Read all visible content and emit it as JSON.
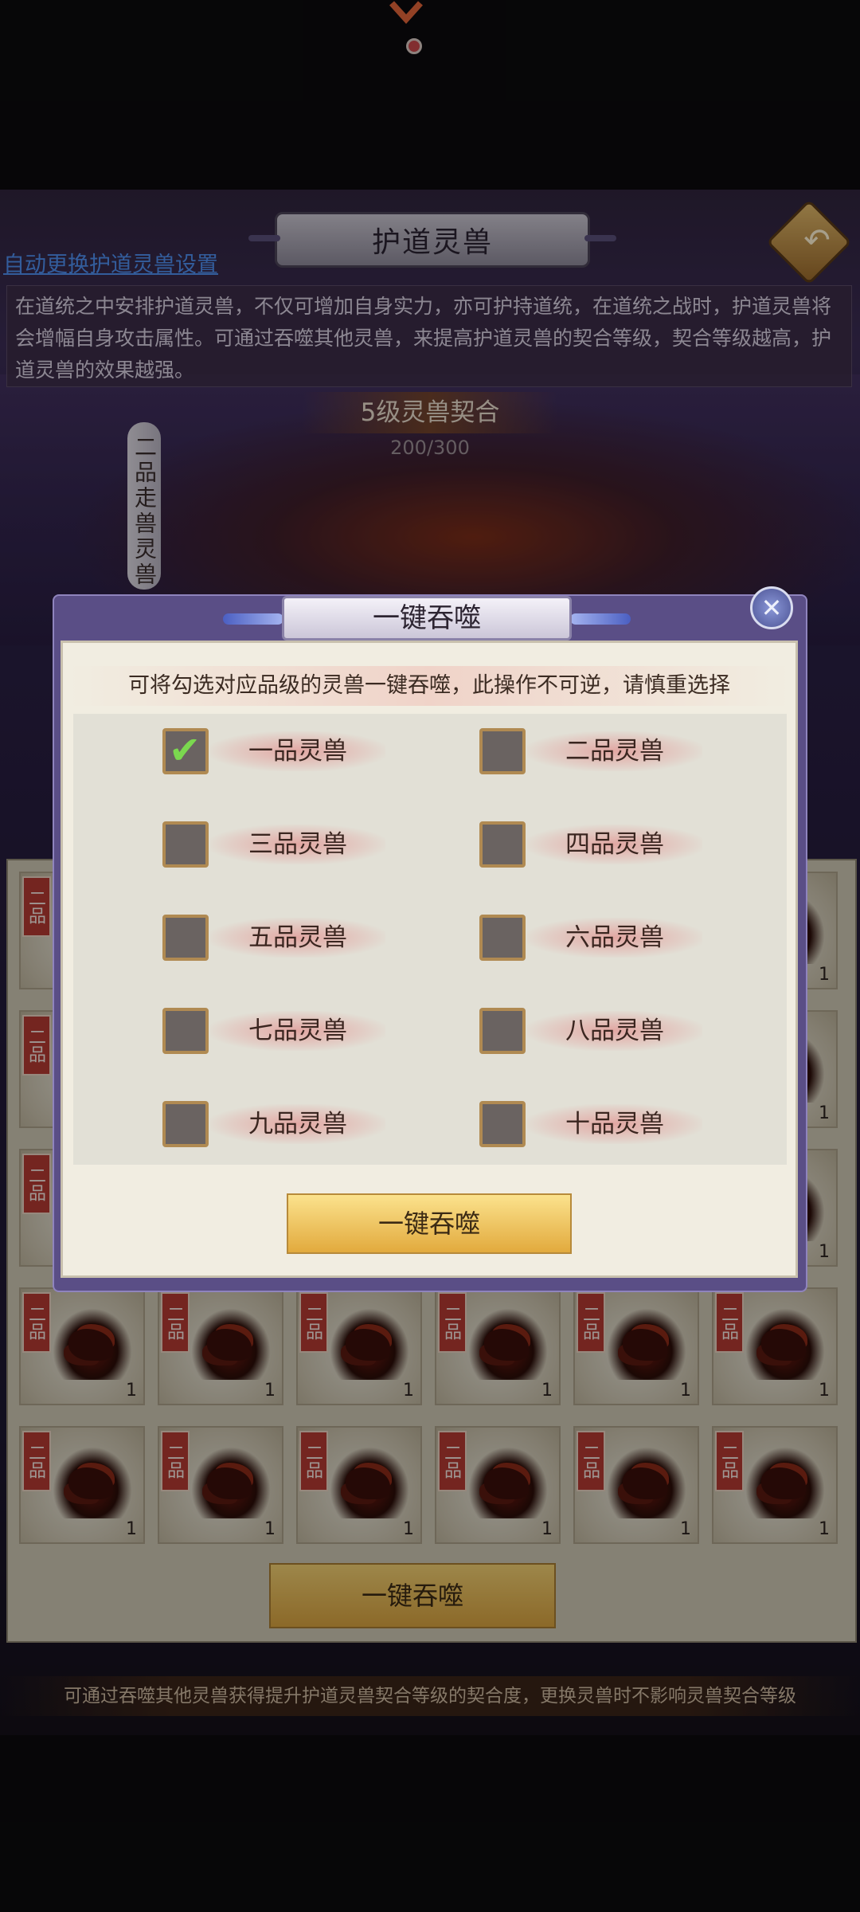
{
  "header": {
    "title": "护道灵兽",
    "auto_link": "自动更换护道灵兽设置",
    "description": "在道统之中安排护道灵兽，不仅可增加自身实力，亦可护持道统，在道统之战时，护道灵兽将会增幅自身攻击属性。可通过吞噬其他灵兽，来提高护道灵兽的契合等级，契合等级越高，护道灵兽的效果越强。"
  },
  "beast": {
    "bond_level": "5级灵兽契合",
    "bond_progress": "200/300",
    "name_vertical": "二品走兽灵兽"
  },
  "grid": {
    "badge": "二品",
    "count": "1",
    "eat_button": "一键吞噬"
  },
  "bottom_note": "可通过吞噬其他灵兽获得提升护道灵兽契合等级的契合度，更换灵兽时不影响灵兽契合等级",
  "modal": {
    "title": "一键吞噬",
    "instruction": "可将勾选对应品级的灵兽一键吞噬，此操作不可逆，请慎重选择",
    "options": [
      {
        "label": "一品灵兽",
        "checked": true
      },
      {
        "label": "二品灵兽",
        "checked": false
      },
      {
        "label": "三品灵兽",
        "checked": false
      },
      {
        "label": "四品灵兽",
        "checked": false
      },
      {
        "label": "五品灵兽",
        "checked": false
      },
      {
        "label": "六品灵兽",
        "checked": false
      },
      {
        "label": "七品灵兽",
        "checked": false
      },
      {
        "label": "八品灵兽",
        "checked": false
      },
      {
        "label": "九品灵兽",
        "checked": false
      },
      {
        "label": "十品灵兽",
        "checked": false
      }
    ],
    "confirm_button": "一键吞噬"
  },
  "icons": {
    "close": "close-icon",
    "back": "back-arrow-icon",
    "check": "checkmark-icon"
  }
}
